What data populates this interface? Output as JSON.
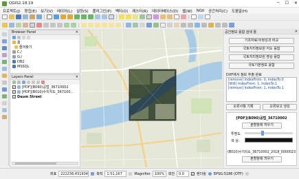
{
  "window": {
    "title": "QGIS2.18.19",
    "minimize": "─",
    "maximize": "☐",
    "close": "✕"
  },
  "menu": [
    "프로젝트(J)",
    "편집(E)",
    "보기(V)",
    "레이어(L)",
    "설정(S)",
    "플러그인(P)",
    "벡터(O)",
    "래스터(R)",
    "데이터베이스(D)",
    "웹(W)",
    "NGII",
    "공간처리(C)",
    "도움말(H)"
  ],
  "browser": {
    "title": "Browser Panel",
    "items": [
      {
        "label": "홈",
        "icon": "home-icon"
      },
      {
        "label": "즐겨찾기",
        "icon": "star-icon"
      },
      {
        "label": "C:/",
        "icon": "drive-icon"
      },
      {
        "label": "G:/",
        "icon": "drive-icon"
      },
      {
        "label": "DB2",
        "icon": "database-icon"
      },
      {
        "label": "MSSQL",
        "icon": "database-icon"
      }
    ]
  },
  "layers": {
    "title": "Layers Panel",
    "items": [
      {
        "label": "[PDF](B090)공법_36710002",
        "checked": true
      },
      {
        "label": "[PDF](B010)수치지도_367100...",
        "checked": true
      },
      {
        "label": "Daum Street",
        "checked": true
      }
    ]
  },
  "right_panel": {
    "title": "공간정보 융합 검색 툴",
    "buttons": [
      "기초자료/수정성과 비교",
      "국토지리정보원 지도 융합",
      "국토지리정보원 영상 융합",
      "국토기본정보 융합"
    ],
    "status_title": "DXF에서 정보 추출 완료",
    "log": [
      "[remove] IndexFrom: 0, IndexTo:0",
      "[Will] IndexFrom: 1, IndexTo:1",
      "[remove] IndexFrom: 1, IndexTo:1"
    ],
    "action_left": "오류사항 기록",
    "action_right": "오류보고 생성",
    "layer1_name": "[PDF](B090)공법_36710002",
    "layer1_btn": "분할창에 띄우기",
    "opacity_label": "투명도",
    "color_label": "색 상:",
    "layer2_name": "(B010)수치지도_36710002_2018_0000023",
    "layer2_btn": "분할창에 띄우기",
    "colors": {
      "swatch": "#111111",
      "accent": "#6aa0d8"
    }
  },
  "status": {
    "coord_label": "좌표",
    "coord_value": "222236,431934",
    "scale_label": "축척",
    "scale_value": "1:51,167",
    "magnifier_label": "Magnifier",
    "magnifier_value": "100%",
    "rotation_label": "회전",
    "rotation_value": "0.0",
    "render_label": "렌더링",
    "crs": "EPSG:5186 (OTF)"
  }
}
